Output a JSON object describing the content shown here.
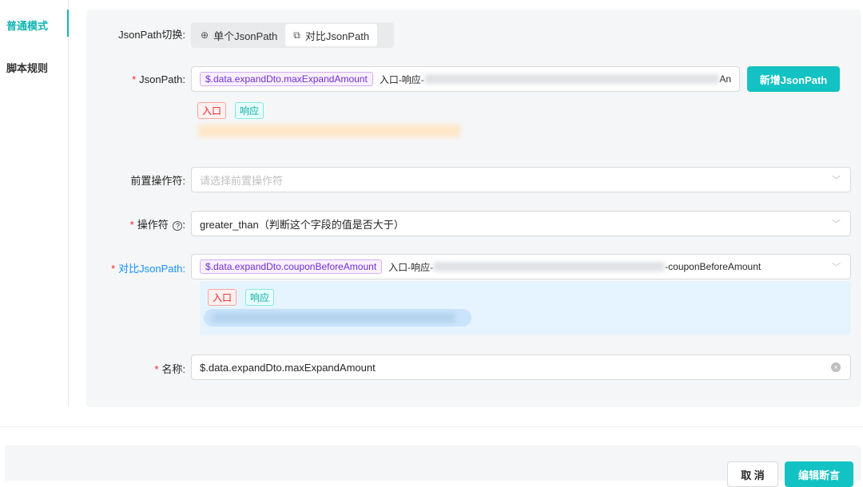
{
  "sidebar": {
    "tabs": [
      {
        "label": "普通模式",
        "active": true
      },
      {
        "label": "脚本规则",
        "active": false
      }
    ]
  },
  "form": {
    "switch": {
      "label": "JsonPath切换:",
      "options": [
        {
          "label": "单个JsonPath",
          "icon": "target-icon",
          "selected": false
        },
        {
          "label": "对比JsonPath",
          "icon": "compare-icon",
          "selected": true
        }
      ]
    },
    "jsonpath": {
      "label": "JsonPath:",
      "tag": "$.data.expandDto.maxExpandAmount",
      "prefix": "入口-响应-",
      "suffix": "An",
      "add_button": "新增JsonPath",
      "tags": [
        "入口",
        "响应"
      ]
    },
    "pre_operator": {
      "label": "前置操作符:",
      "placeholder": "请选择前置操作符"
    },
    "operator": {
      "label": "操作符",
      "value": "greater_than（判断这个字段的值是否大于）"
    },
    "compare_jsonpath": {
      "label": "对比JsonPath:",
      "tag": "$.data.expandDto.couponBeforeAmount",
      "prefix": "入口-响应-",
      "suffix": "-couponBeforeAmount",
      "tags": [
        "入口",
        "响应"
      ]
    },
    "name": {
      "label": "名称:",
      "value": "$.data.expandDto.maxExpandAmount"
    }
  },
  "footer": {
    "cancel": "取 消",
    "submit": "编辑断言"
  },
  "colors": {
    "accent": "#13c2c2",
    "active_tab": "#13b5b1",
    "required": "#f5222d",
    "link": "#1890ff"
  }
}
